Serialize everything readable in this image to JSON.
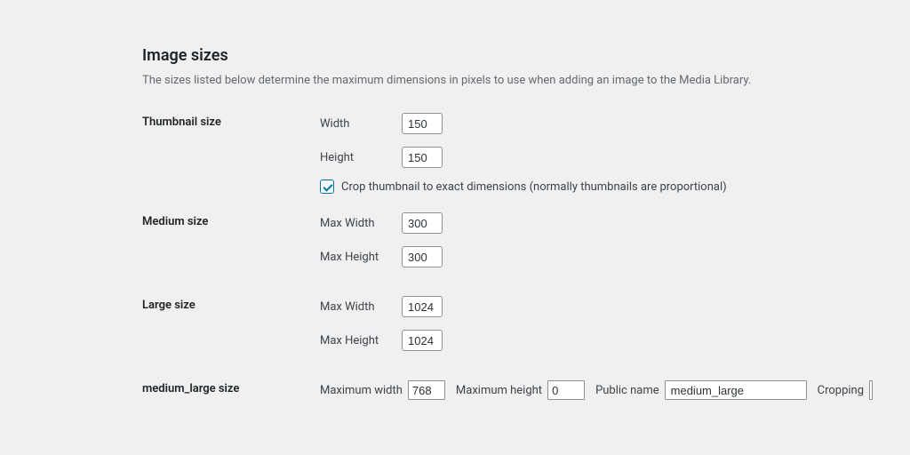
{
  "heading": "Image sizes",
  "description": "The sizes listed below determine the maximum dimensions in pixels to use when adding an image to the Media Library.",
  "thumbnail": {
    "section_label": "Thumbnail size",
    "width_label": "Width",
    "width_value": "150",
    "height_label": "Height",
    "height_value": "150",
    "crop_checked": true,
    "crop_label": "Crop thumbnail to exact dimensions (normally thumbnails are proportional)"
  },
  "medium": {
    "section_label": "Medium size",
    "max_width_label": "Max Width",
    "max_width_value": "300",
    "max_height_label": "Max Height",
    "max_height_value": "300"
  },
  "large": {
    "section_label": "Large size",
    "max_width_label": "Max Width",
    "max_width_value": "1024",
    "max_height_label": "Max Height",
    "max_height_value": "1024"
  },
  "medium_large": {
    "section_label": "medium_large size",
    "max_width_label": "Maximum width",
    "max_width_value": "768",
    "max_height_label": "Maximum height",
    "max_height_value": "0",
    "public_name_label": "Public name",
    "public_name_value": "medium_large",
    "cropping_label": "Cropping",
    "cropping_value": ""
  }
}
